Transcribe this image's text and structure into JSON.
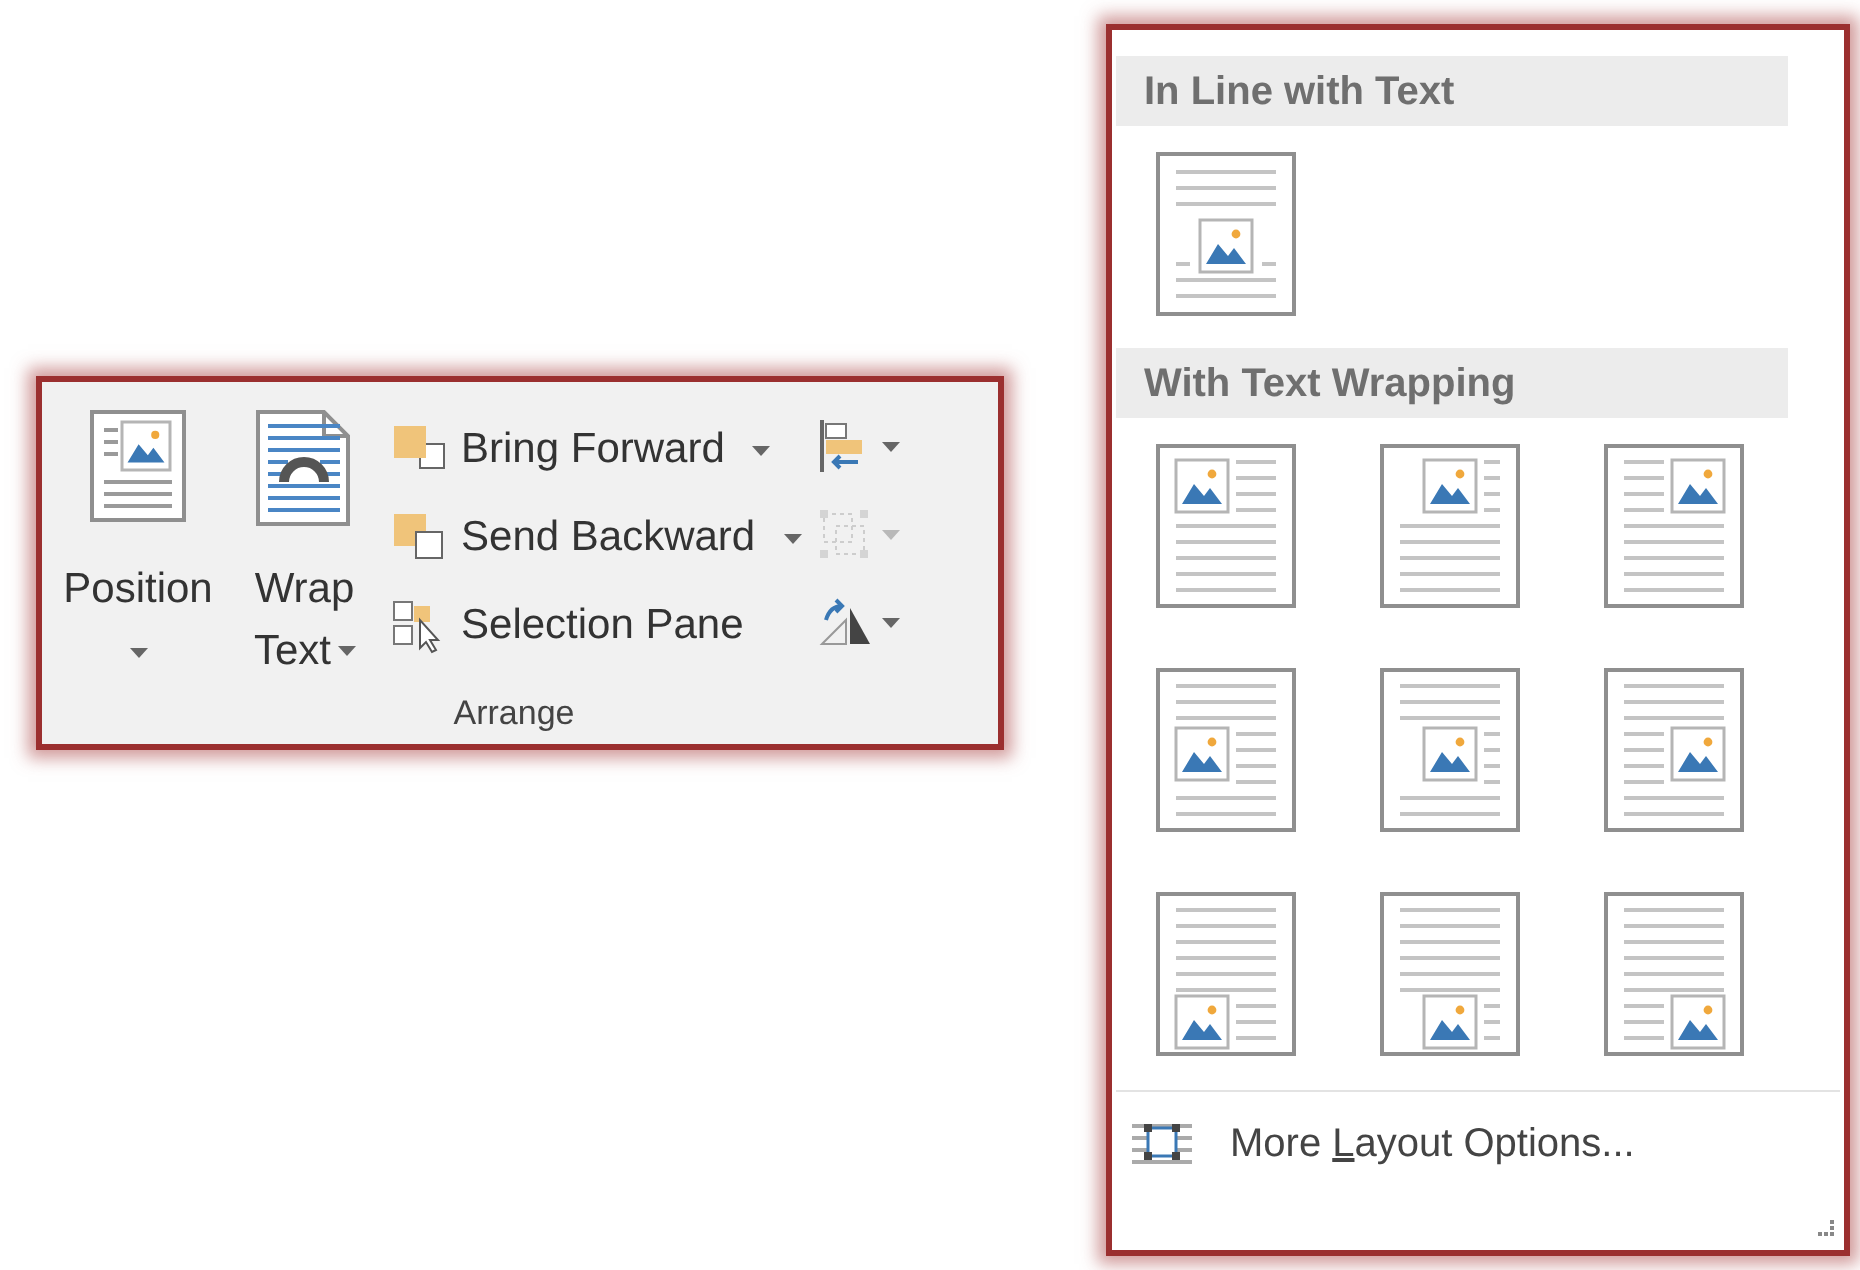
{
  "ribbon_group": {
    "label": "Arrange",
    "large_buttons": [
      {
        "kind": "position",
        "lines": [
          "Position"
        ]
      },
      {
        "kind": "wrap",
        "lines": [
          "Wrap",
          "Text"
        ]
      }
    ],
    "small_buttons": [
      {
        "kind": "bring-forward",
        "label": "Bring Forward",
        "dropdown": true
      },
      {
        "kind": "send-backward",
        "label": "Send Backward",
        "dropdown": true
      },
      {
        "kind": "selection-pane",
        "label": "Selection Pane",
        "dropdown": false
      }
    ],
    "icon_buttons": [
      {
        "kind": "align",
        "disabled": false
      },
      {
        "kind": "group",
        "disabled": true
      },
      {
        "kind": "rotate",
        "disabled": false
      }
    ]
  },
  "wrap_menu": {
    "sections": [
      {
        "title": "In Line with Text",
        "items": [
          {
            "kind": "inline"
          }
        ]
      },
      {
        "title": "With Text Wrapping",
        "items": [
          {
            "kind": "top-left"
          },
          {
            "kind": "top-center"
          },
          {
            "kind": "top-right"
          },
          {
            "kind": "middle-left"
          },
          {
            "kind": "middle-center"
          },
          {
            "kind": "middle-right"
          },
          {
            "kind": "bottom-left"
          },
          {
            "kind": "bottom-center"
          },
          {
            "kind": "bottom-right"
          }
        ]
      }
    ],
    "footer": {
      "label": "More Layout Options..."
    }
  }
}
